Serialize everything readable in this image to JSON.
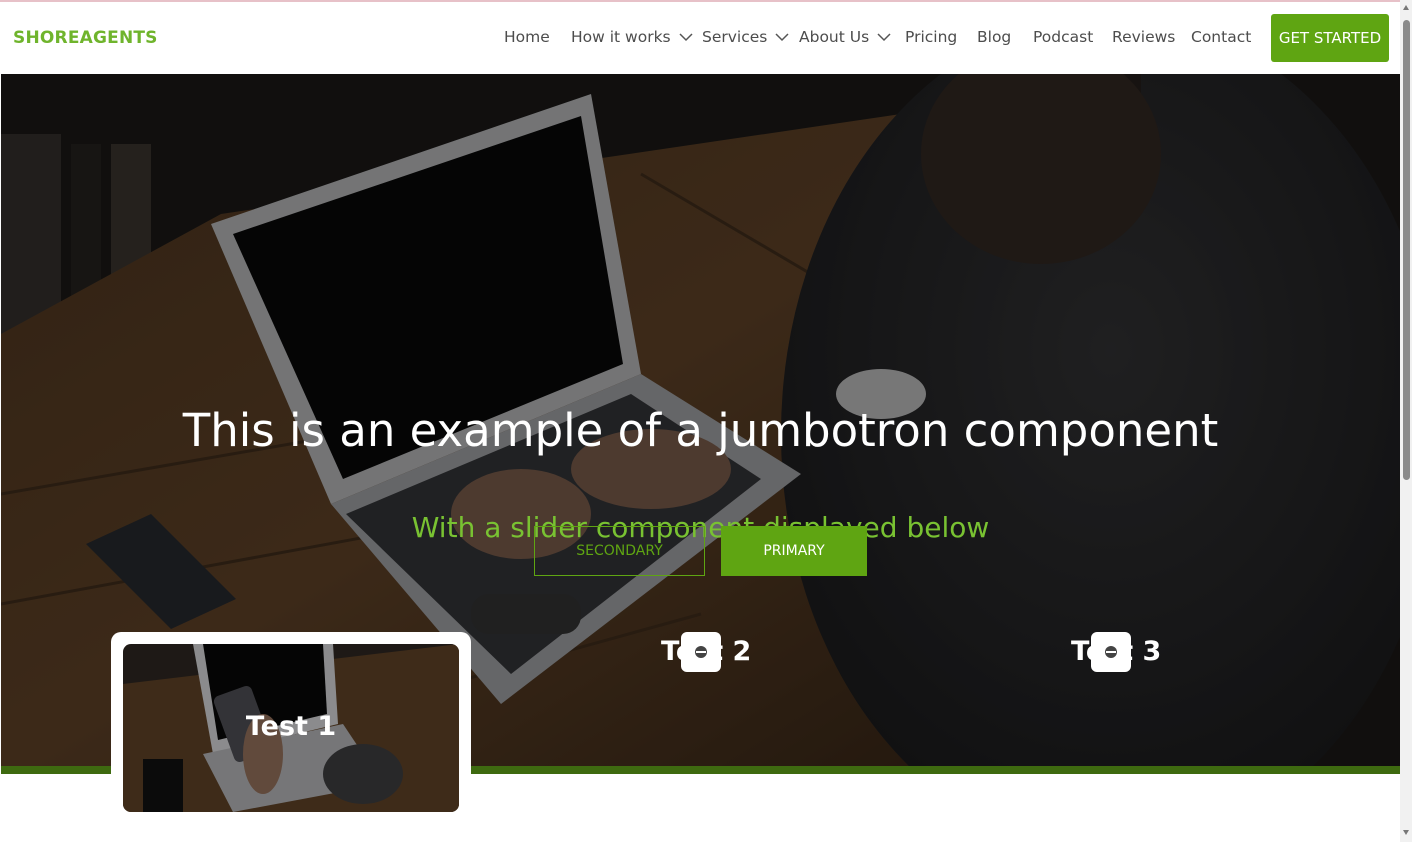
{
  "brand": "SHOREAGENTS",
  "nav": {
    "home": "Home",
    "how_it_works": "How it works",
    "services": "Services",
    "about_us": "About Us",
    "pricing": "Pricing",
    "blog": "Blog",
    "podcast": "Podcast",
    "reviews": "Reviews",
    "contact": "Contact",
    "cta": "GET STARTED"
  },
  "hero": {
    "title": "This is an example of a jumbotron component",
    "subtitle": "With a slider component displayed below",
    "secondary_button": "SECONDARY",
    "primary_button": "PRIMARY"
  },
  "slider": {
    "slides": [
      {
        "label": "Test 1"
      },
      {
        "label": "Test 2"
      },
      {
        "label": "Test 3"
      }
    ]
  },
  "colors": {
    "accent": "#5fa512",
    "brand": "#6fb42c",
    "bar": "#3e6a10"
  }
}
